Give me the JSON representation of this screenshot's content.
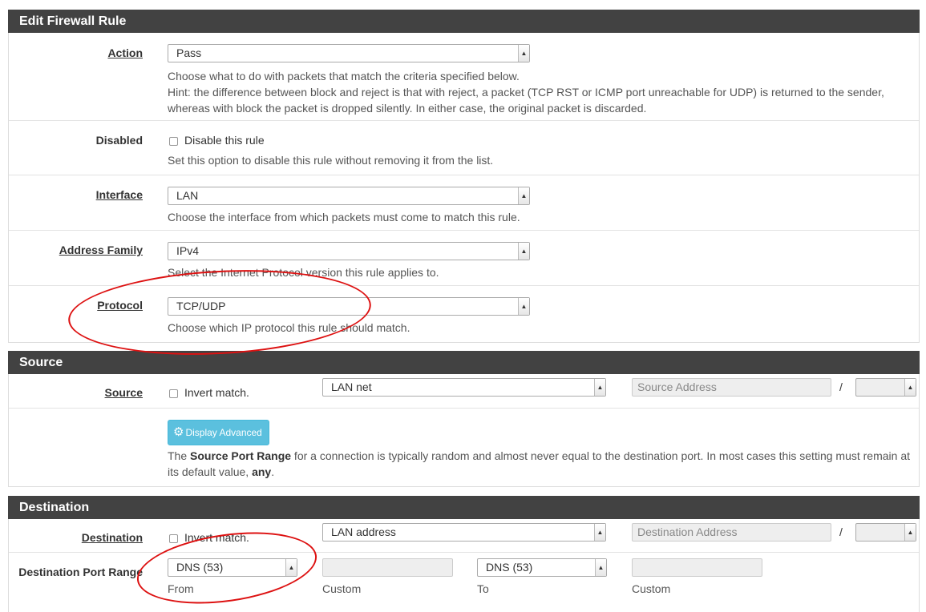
{
  "edit_rule": {
    "title": "Edit Firewall Rule",
    "action": {
      "label": "Action",
      "value": "Pass",
      "help1": "Choose what to do with packets that match the criteria specified below.",
      "help2": "Hint: the difference between block and reject is that with reject, a packet (TCP RST or ICMP port unreachable for UDP) is returned to the sender,",
      "help3": "whereas with block the packet is dropped silently. In either case, the original packet is discarded."
    },
    "disabled": {
      "label": "Disabled",
      "checkbox_label": "Disable this rule",
      "help": "Set this option to disable this rule without removing it from the list."
    },
    "interface": {
      "label": "Interface",
      "value": "LAN",
      "help": "Choose the interface from which packets must come to match this rule."
    },
    "address_family": {
      "label": "Address Family",
      "value": "IPv4",
      "help": "Select the Internet Protocol version this rule applies to."
    },
    "protocol": {
      "label": "Protocol",
      "value": "TCP/UDP",
      "help": "Choose which IP protocol this rule should match."
    }
  },
  "source": {
    "title": "Source",
    "label": "Source",
    "invert_label": "Invert match.",
    "type_value": "LAN net",
    "address_placeholder": "Source Address",
    "slash": "/",
    "advanced_button": "Display Advanced",
    "help_pre": "The ",
    "help_bold": "Source Port Range",
    "help_mid": " for a connection is typically random and almost never equal to the destination port. In most cases this setting must remain at",
    "help_line2_pre": "its default value, ",
    "help_line2_bold": "any",
    "help_line2_post": "."
  },
  "destination": {
    "title": "Destination",
    "label": "Destination",
    "invert_label": "Invert match.",
    "type_value": "LAN address",
    "address_placeholder": "Destination Address",
    "slash": "/",
    "port_range_label": "Destination Port Range",
    "from_value": "DNS (53)",
    "from_label": "From",
    "custom_label": "Custom",
    "to_value": "DNS (53)",
    "to_label": "To",
    "custom_label2": "Custom"
  },
  "colors": {
    "header_bg": "#424242",
    "button": "#5bc0de",
    "annotation": "#dd1111"
  }
}
